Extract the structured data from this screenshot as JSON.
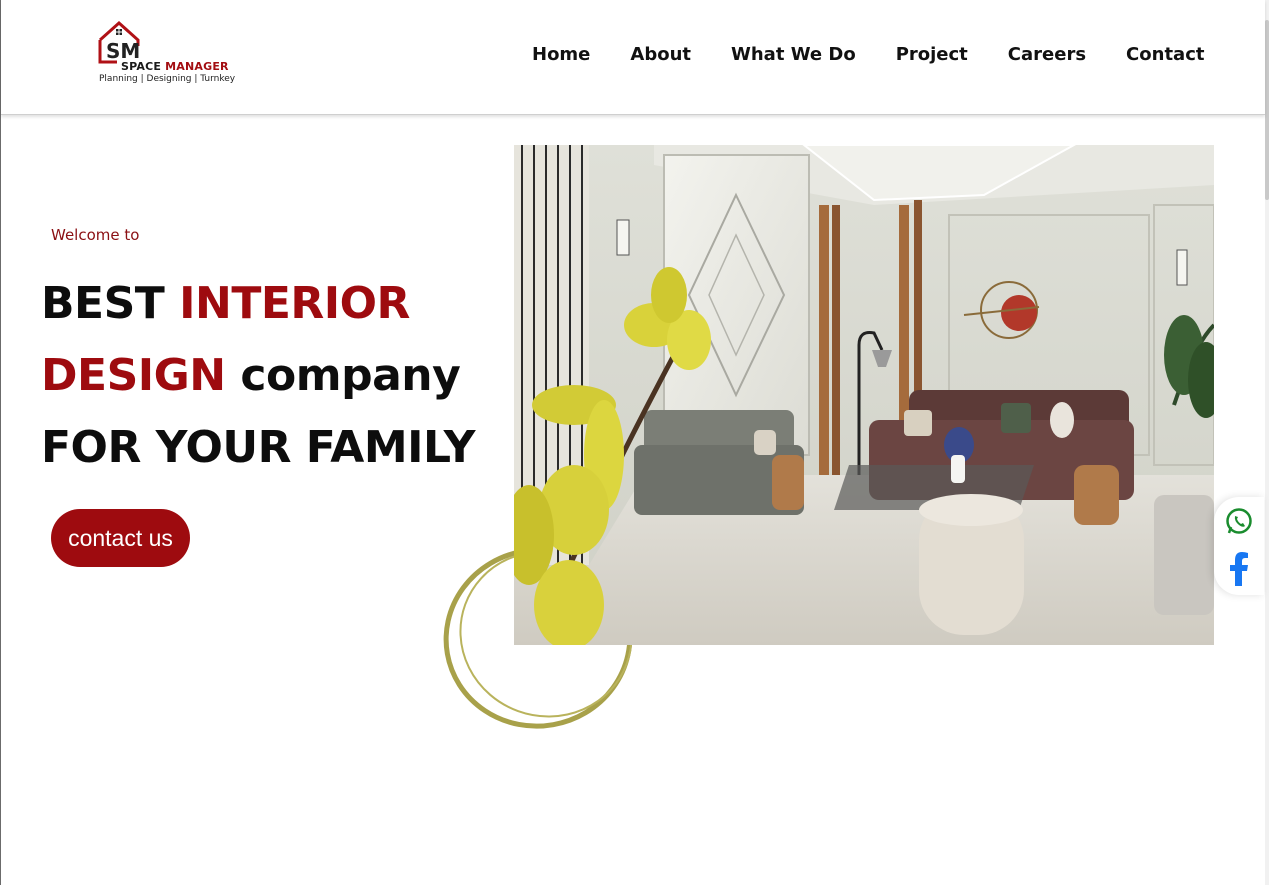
{
  "brand": {
    "monogram": "SM",
    "name_part1": "SPACE",
    "name_part2": "MANAGER",
    "tagline": "Planning | Designing | Turnkey"
  },
  "nav": {
    "items": [
      "Home",
      "About",
      "What We Do",
      "Project",
      "Careers",
      "Contact"
    ]
  },
  "hero": {
    "welcome": "Welcome to",
    "line1_a": "BEST",
    "line1_b": "INTERIOR",
    "line2_a": "DESIGN",
    "line2_b": "company",
    "line3": "FOR YOUR FAMILY",
    "cta_label": "contact us",
    "image": "living-room-interior-photo"
  },
  "social": {
    "icons": [
      "whatsapp-icon",
      "facebook-icon"
    ]
  },
  "colors": {
    "accent": "#9e0b0f",
    "ring": "#a8a14a",
    "whatsapp": "#1a8c2e",
    "facebook": "#1877f2"
  }
}
